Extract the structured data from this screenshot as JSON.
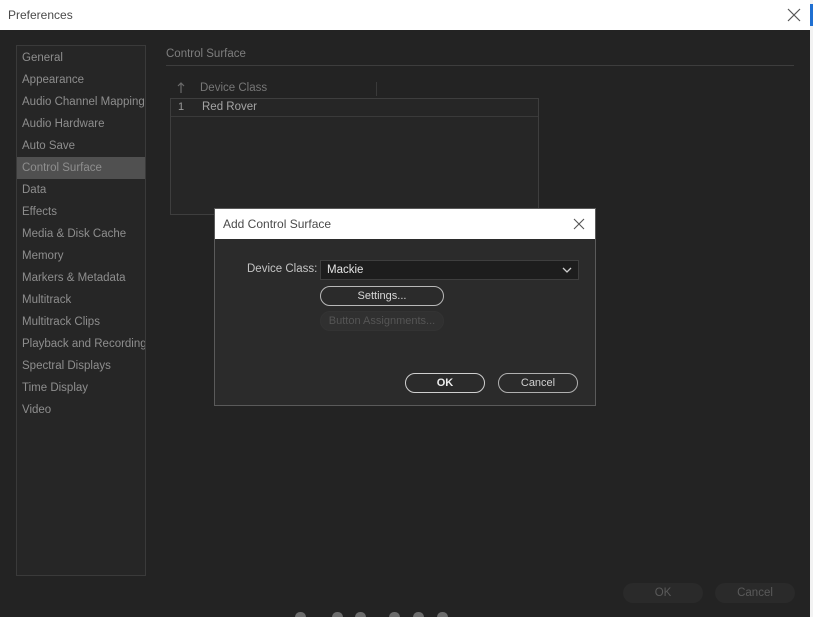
{
  "window": {
    "title": "Preferences"
  },
  "sidebar": {
    "items": [
      {
        "label": "General"
      },
      {
        "label": "Appearance"
      },
      {
        "label": "Audio Channel Mapping"
      },
      {
        "label": "Audio Hardware"
      },
      {
        "label": "Auto Save"
      },
      {
        "label": "Control Surface",
        "selected": true
      },
      {
        "label": "Data"
      },
      {
        "label": "Effects"
      },
      {
        "label": "Media & Disk Cache"
      },
      {
        "label": "Memory"
      },
      {
        "label": "Markers & Metadata"
      },
      {
        "label": "Multitrack"
      },
      {
        "label": "Multitrack Clips"
      },
      {
        "label": "Playback and Recording"
      },
      {
        "label": "Spectral Displays"
      },
      {
        "label": "Time Display"
      },
      {
        "label": "Video"
      }
    ]
  },
  "section": {
    "title": "Control Surface",
    "table": {
      "columns": [
        "Device Class"
      ],
      "rows": [
        {
          "index": "1",
          "device_class": "Red Rover"
        }
      ]
    }
  },
  "footer": {
    "ok_label": "OK",
    "cancel_label": "Cancel"
  },
  "dialog": {
    "title": "Add Control Surface",
    "device_class_label": "Device Class:",
    "device_class_value": "Mackie",
    "settings_label": "Settings...",
    "button_assignments_label": "Button Assignments...",
    "ok_label": "OK",
    "cancel_label": "Cancel"
  },
  "icons": {
    "close": "close-icon",
    "sort": "sort-up-arrow-icon",
    "dropdown": "chevron-down-icon"
  }
}
